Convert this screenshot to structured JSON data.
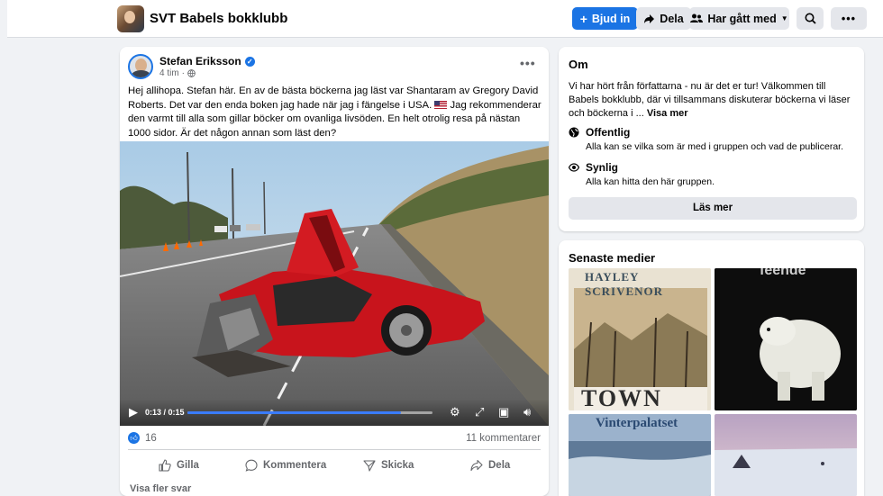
{
  "group": {
    "name": "SVT Babels bokklubb"
  },
  "toolbar": {
    "invite_label": "Bjud in",
    "share_label": "Dela",
    "joined_label": "Har gått med"
  },
  "post": {
    "author": "Stefan Eriksson",
    "time": "4 tim",
    "text_part1": "Hej allihopa. Stefan här. En av de bästa böckerna jag läst var Shantaram av Gregory David Roberts. Det var den enda boken jag hade när jag i fängelse i USA.",
    "text_part2": "Jag rekommenderar den varmt till alla som gillar böcker om ovanliga livsöden. En helt otrolig resa på nästan 1000 sidor. Är det någon annan som läst den?",
    "video": {
      "time_display": "0:13 / 0:15",
      "progress": 0.87
    },
    "reaction_count": "16",
    "comment_count": "11 kommentarer",
    "actions": {
      "like": "Gilla",
      "comment": "Kommentera",
      "send": "Skicka",
      "share": "Dela"
    },
    "more_replies": "Visa fler svar"
  },
  "about": {
    "title": "Om",
    "description": "Vi har hört från författarna - nu är det er tur! Välkommen till Babels bokklubb, där vi tillsammans diskuterar böckerna vi läser och böckerna i ...",
    "see_more": "Visa mer",
    "public_title": "Offentlig",
    "public_desc": "Alla kan se vilka som är med i gruppen och vad de publicerar.",
    "visible_title": "Synlig",
    "visible_desc": "Alla kan hitta den här gruppen.",
    "read_more": "Läs mer"
  },
  "media": {
    "title": "Senaste medier",
    "thumb1_title": "HAYLEY SCRIVENOR",
    "thumb1_word": "TOWN",
    "thumb2_word": "feende",
    "thumb3_title": "Vinterpalatset"
  },
  "colors": {
    "accent": "#1b74e4",
    "background": "#f0f2f5"
  }
}
